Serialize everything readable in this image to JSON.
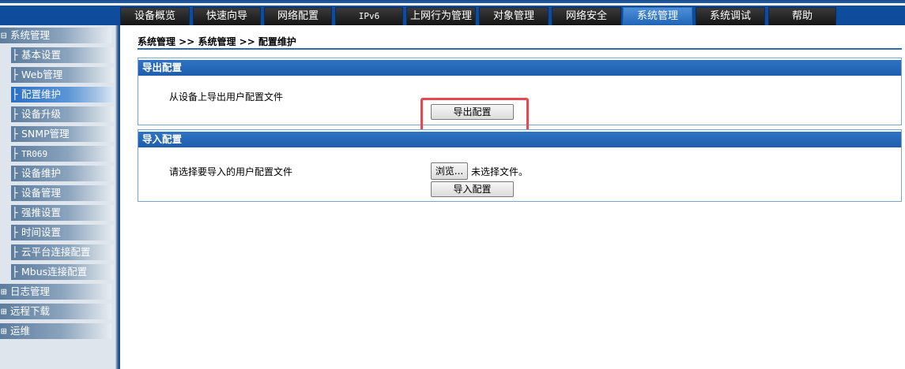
{
  "nav": {
    "tabs": [
      {
        "label": "设备概览"
      },
      {
        "label": "快速向导"
      },
      {
        "label": "网络配置"
      },
      {
        "label": "IPv6"
      },
      {
        "label": "上网行为管理"
      },
      {
        "label": "对象管理"
      },
      {
        "label": "网络安全"
      },
      {
        "label": "系统管理",
        "active": true
      },
      {
        "label": "系统调试"
      },
      {
        "label": "帮助"
      }
    ]
  },
  "sidebar": {
    "expanded_glyph": "⊟",
    "collapsed_glyph": "⊞",
    "branch_glyph": "├",
    "groups": [
      {
        "label": "系统管理",
        "expanded": true,
        "items": [
          {
            "label": "基本设置"
          },
          {
            "label": "Web管理"
          },
          {
            "label": "配置维护",
            "active": true
          },
          {
            "label": "设备升级"
          },
          {
            "label": "SNMP管理"
          },
          {
            "label": "TR069"
          },
          {
            "label": "设备维护"
          },
          {
            "label": "设备管理"
          },
          {
            "label": "强推设置"
          },
          {
            "label": "时间设置"
          },
          {
            "label": "云平台连接配置"
          },
          {
            "label": "Mbus连接配置"
          }
        ]
      },
      {
        "label": "日志管理",
        "expanded": false
      },
      {
        "label": "远程下载",
        "expanded": false
      },
      {
        "label": "运维",
        "expanded": false
      }
    ]
  },
  "main": {
    "breadcrumb": "系统管理 >> 系统管理 >> 配置维护",
    "export_panel": {
      "title": "导出配置",
      "description": "从设备上导出用户配置文件",
      "button_label": "导出配置"
    },
    "import_panel": {
      "title": "导入配置",
      "description": "请选择要导入的用户配置文件",
      "browse_label": "浏览...",
      "file_status": "未选择文件。",
      "button_label": "导入配置"
    }
  },
  "colors": {
    "nav_bar": "#0e4a98",
    "active_tab": "#2b75c8",
    "panel_header": "#2368b8",
    "highlight_box": "#e8474f"
  }
}
